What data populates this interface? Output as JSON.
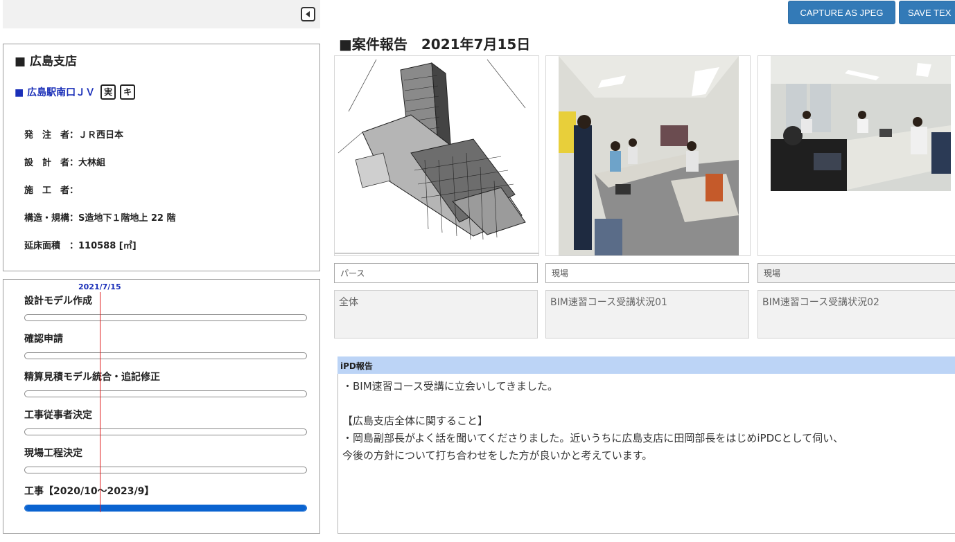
{
  "toolbar": {
    "capture_label": "CAPTURE AS JPEG",
    "save_text_label": "SAVE TEX"
  },
  "sidebar": {
    "collapse_icon": "triangle-left-icon",
    "branch_title": "■ 広島支店",
    "project_name": "■ 広島駅南口ＪＶ",
    "tags": [
      "実",
      "キ"
    ],
    "info_rows": [
      "発　注　者：ＪＲ西日本",
      "設　計　者：大林組",
      "施　工　者：",
      "構造・規構：S造地下１階地上 22 階",
      "延床面積　：110588 [㎡]"
    ]
  },
  "schedule": {
    "today_label": "2021/7/15",
    "tasks": [
      {
        "label": "設計モデル作成",
        "progress": 0
      },
      {
        "label": "確認申請",
        "progress": 0
      },
      {
        "label": "精算見積モデル統合・追記修正",
        "progress": 0
      },
      {
        "label": "工事従事者決定",
        "progress": 0
      },
      {
        "label": "現場工程決定",
        "progress": 0
      },
      {
        "label": "工事【2020/10～2023/9】",
        "progress": 1.0
      }
    ],
    "bar_color": "#0a63d0",
    "today_line_color": "#e02020"
  },
  "report": {
    "title": "■案件報告　2021年7月15日",
    "photos": [
      {
        "caption": "パース",
        "description": "全体"
      },
      {
        "caption": "現場",
        "description": "BIM速習コース受講状況01"
      },
      {
        "caption": "現場",
        "description": "BIM速習コース受講状況02"
      }
    ],
    "ipd_header": "iPD報告",
    "ipd_lines": [
      "・BIM速習コース受講に立会いしてきました。",
      "",
      "【広島支店全体に関すること】",
      "・岡島副部長がよく話を聞いてくださりました。近いうちに広島支店に田岡部長をはじめiPDCとして伺い、",
      "今後の方針について打ち合わせをした方が良いかと考えています。"
    ]
  },
  "colors": {
    "accent_button": "#337ab7",
    "project_link": "#1a2fb8",
    "ipd_header_bg": "#bcd4f6"
  }
}
